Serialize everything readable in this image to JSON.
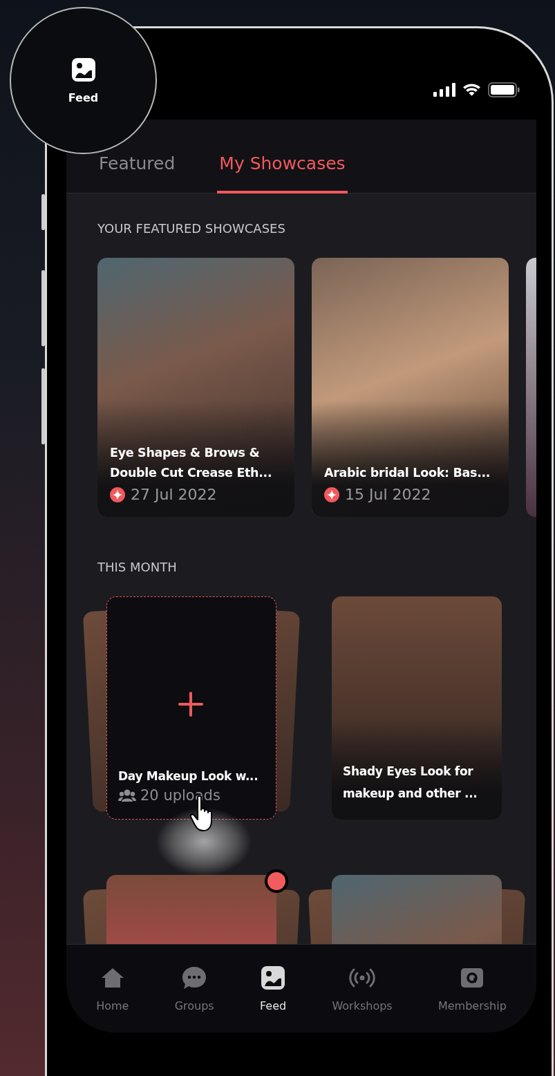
{
  "magnifier": {
    "label": "Feed"
  },
  "tabs": [
    {
      "label": "Featured",
      "selected": false
    },
    {
      "label": "My Showcases",
      "selected": true
    }
  ],
  "featured": {
    "heading": "YOUR FEATURED SHOWCASES",
    "cards": [
      {
        "title": "Eye Shapes & Brows & Double Cut Crease Eth...",
        "date": "27 Jul 2022"
      },
      {
        "title": "Arabic bridal Look: Bas...",
        "date": "15 Jul 2022"
      },
      {
        "kind": "photo"
      }
    ]
  },
  "this_month": {
    "heading": "THIS MONTH",
    "cards": [
      {
        "kind": "add",
        "stacked": true,
        "title": "Day Makeup Look w...",
        "uploads": "20 uploads",
        "new": false
      },
      {
        "kind": "photo",
        "stacked": false,
        "title": "Shady Eyes Look for makeup and other ...",
        "new": false
      },
      {
        "kind": "photo",
        "stacked": true,
        "new": true
      },
      {
        "kind": "photo",
        "stacked": true,
        "new": false
      }
    ]
  },
  "nav": [
    {
      "label": "Home",
      "selected": false
    },
    {
      "label": "Groups",
      "selected": false
    },
    {
      "label": "Feed",
      "selected": true
    },
    {
      "label": "Workshops",
      "selected": false
    },
    {
      "label": "Membership",
      "selected": false
    }
  ]
}
